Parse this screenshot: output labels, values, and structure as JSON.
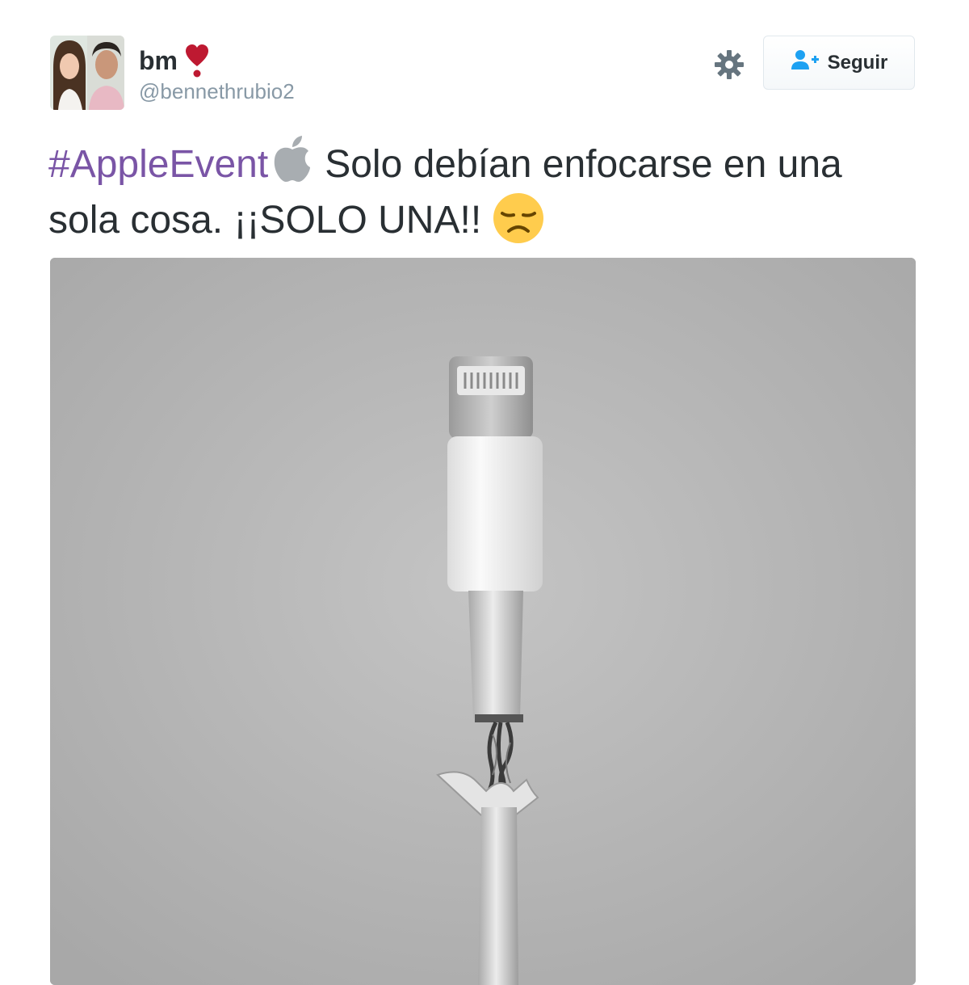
{
  "author": {
    "display_name": "bm",
    "handle": "@bennethrubio2"
  },
  "header": {
    "follow_label": "Seguir"
  },
  "tweet": {
    "hashtag": "#AppleEvent",
    "text_line1": "Solo debían enfocarse en una",
    "text_line2": "sola cosa. ¡¡SOLO UNA!!"
  },
  "icons": {
    "heart": "heavy-heart-exclamation-icon",
    "apple": "apple-emoji-icon",
    "sad": "disappointed-face-emoji-icon",
    "gear": "gear-icon",
    "follow": "add-user-icon"
  },
  "colors": {
    "hashtag": "#7a55a6",
    "handle": "#8899a6",
    "follow_icon": "#1da1f2",
    "heart": "#be1931"
  }
}
